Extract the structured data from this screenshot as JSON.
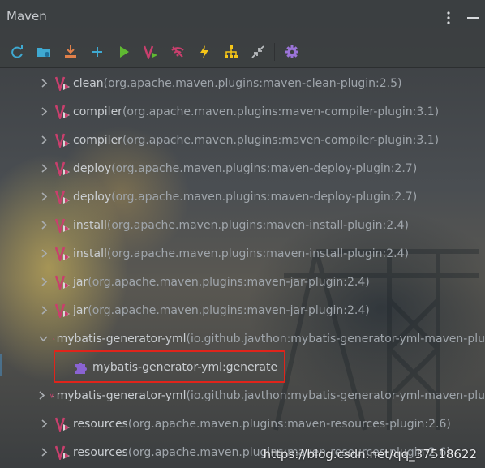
{
  "window": {
    "title": "Maven"
  },
  "toolbar": {
    "buttons": [
      {
        "icon": "reload-icon",
        "color": "#3fa9d1"
      },
      {
        "icon": "open-folder-icon",
        "color": "#3fa9d1"
      },
      {
        "icon": "download-sources-icon",
        "color": "#e0804a"
      },
      {
        "icon": "add-icon",
        "color": "#3fa9d1"
      },
      {
        "icon": "run-icon",
        "color": "#5fb832"
      },
      {
        "icon": "execute-goal-icon",
        "color": "#c93f6d"
      },
      {
        "icon": "offline-mode-icon",
        "color": "#c93f6d"
      },
      {
        "icon": "skip-tests-icon",
        "color": "#f5c518"
      },
      {
        "icon": "dependencies-diagram-icon",
        "color": "#f5c518"
      },
      {
        "icon": "collapse-all-icon",
        "color": "#b9bcbf"
      },
      {
        "icon": "settings-icon",
        "color": "#9b74d8"
      }
    ]
  },
  "tree": {
    "rows": [
      {
        "name": "clean",
        "gav": " (org.apache.maven.plugins:maven-clean-plugin:2.5)",
        "expanded": false
      },
      {
        "name": "compiler",
        "gav": " (org.apache.maven.plugins:maven-compiler-plugin:3.1)",
        "expanded": false
      },
      {
        "name": "compiler",
        "gav": " (org.apache.maven.plugins:maven-compiler-plugin:3.1)",
        "expanded": false
      },
      {
        "name": "deploy",
        "gav": " (org.apache.maven.plugins:maven-deploy-plugin:2.7)",
        "expanded": false
      },
      {
        "name": "deploy",
        "gav": " (org.apache.maven.plugins:maven-deploy-plugin:2.7)",
        "expanded": false
      },
      {
        "name": "install",
        "gav": " (org.apache.maven.plugins:maven-install-plugin:2.4)",
        "expanded": false
      },
      {
        "name": "install",
        "gav": " (org.apache.maven.plugins:maven-install-plugin:2.4)",
        "expanded": false
      },
      {
        "name": "jar",
        "gav": " (org.apache.maven.plugins:maven-jar-plugin:2.4)",
        "expanded": false
      },
      {
        "name": "jar",
        "gav": " (org.apache.maven.plugins:maven-jar-plugin:2.4)",
        "expanded": false
      },
      {
        "name": "mybatis-generator-yml",
        "gav": " (io.github.javthon:mybatis-generator-yml-maven-plu",
        "expanded": true
      },
      {
        "name": "mybatis-generator-yml:generate",
        "gav": "",
        "goal": true
      },
      {
        "name": "mybatis-generator-yml",
        "gav": " (io.github.javthon:mybatis-generator-yml-maven-plu",
        "expanded": false
      },
      {
        "name": "resources",
        "gav": " (org.apache.maven.plugins:maven-resources-plugin:2.6)",
        "expanded": false
      },
      {
        "name": "resources",
        "gav": " (org.apache.maven.plugins:maven-resources-plugin:2.6)",
        "expanded": false
      }
    ]
  },
  "watermark": "https://blog.csdn.net/qq_37518622"
}
